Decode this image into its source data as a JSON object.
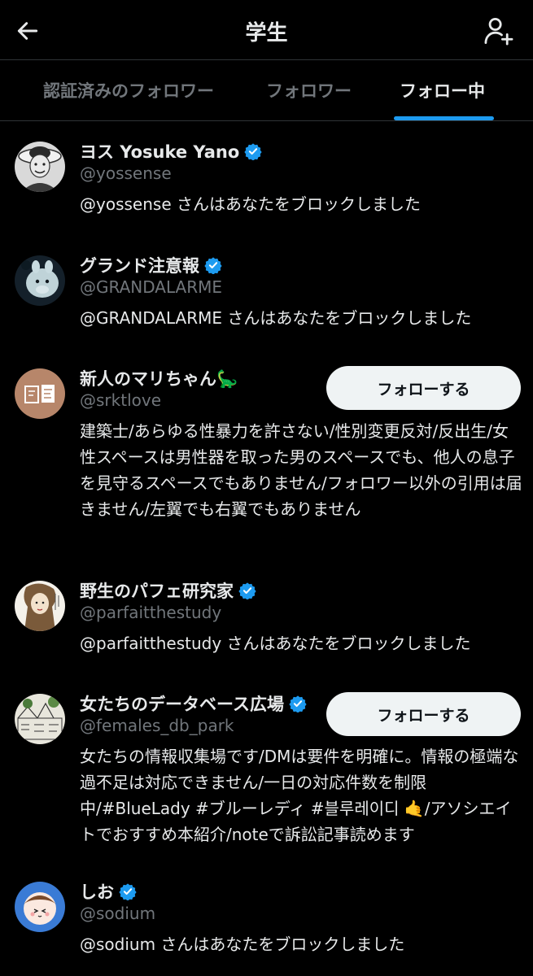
{
  "header": {
    "title": "学生"
  },
  "tabs": [
    {
      "label": "認証済みのフォロワー"
    },
    {
      "label": "フォロワー"
    },
    {
      "label": "フォロー中"
    }
  ],
  "users": [
    {
      "name": "ヨス Yosuke Yano",
      "verified": true,
      "handle": "@yossense",
      "bio": "@yossense さんはあなたをブロックしました"
    },
    {
      "name": "グランド注意報",
      "verified": true,
      "handle": "@GRANDALARME",
      "bio": "@GRANDALARME さんはあなたをブロックしました"
    },
    {
      "name": "新人のマリちゃん🦕",
      "verified": false,
      "handle": "@srktlove",
      "follow_label": "フォローする",
      "bio": "建築士/あらゆる性暴力を許さない/性別変更反対/反出生/女性スペースは男性器を取った男のスペースでも、他人の息子を見守るスペースでもありません/フォロワー以外の引用は届きません/左翼でも右翼でもありません"
    },
    {
      "name": "野生のパフェ研究家",
      "verified": true,
      "handle": "@parfaitthestudy",
      "bio": "@parfaitthestudy さんはあなたをブロックしました"
    },
    {
      "name": "女たちのデータベース広場",
      "verified": true,
      "handle": "@females_db_park",
      "follow_label": "フォローする",
      "bio": "女たちの情報収集場です/DMは要件を明確に。情報の極端な過不足は対応できません/一日の対応件数を制限中/#BlueLady #ブルーレディ #블루레이디 🤙/アソシエイトでおすすめ本紹介/noteで訴訟記事読めます"
    },
    {
      "name": "しお",
      "verified": true,
      "handle": "@sodium",
      "bio": "@sodium さんはあなたをブロックしました"
    }
  ],
  "colors": {
    "background": "#000000",
    "accent": "#1d9bf0",
    "text_primary": "#e7e9ea",
    "text_secondary": "#71767b",
    "button_bg": "#eff3f4"
  },
  "icons": {
    "back": "arrow-left-icon",
    "add_user": "person-plus-icon",
    "verified": "verified-badge-icon"
  }
}
